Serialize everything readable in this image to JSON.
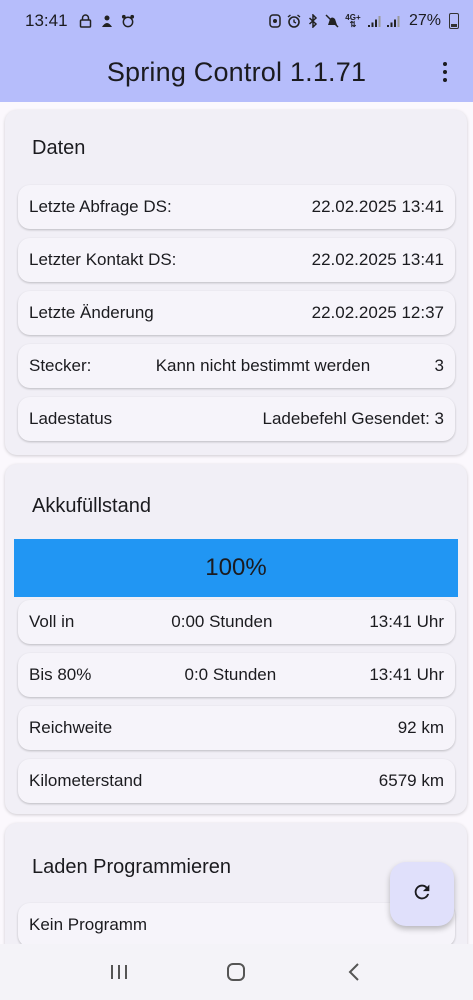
{
  "status_bar": {
    "time": "13:41",
    "battery": "27%",
    "signal_label": "4G+"
  },
  "app": {
    "title": "Spring Control 1.1.71"
  },
  "daten": {
    "title": "Daten",
    "rows": [
      {
        "label": "Letzte Abfrage DS:",
        "value": "22.02.2025 13:41"
      },
      {
        "label": "Letzter Kontakt DS:",
        "value": "22.02.2025 13:41"
      },
      {
        "label": "Letzte Änderung",
        "value": "22.02.2025 12:37"
      },
      {
        "label": "Stecker:",
        "middle": "Kann nicht bestimmt werden",
        "value": "3"
      },
      {
        "label": "Ladestatus",
        "value": "Ladebefehl Gesendet: 3"
      }
    ]
  },
  "akku": {
    "title": "Akkufüllstand",
    "level_text": "100%",
    "level": 1.0,
    "bar_color": "#2196f3",
    "rows": [
      {
        "label": "Voll in",
        "middle": "0:00 Stunden",
        "value": "13:41 Uhr"
      },
      {
        "label": "Bis 80%",
        "middle": "0:0 Stunden",
        "value": "13:41 Uhr"
      },
      {
        "label": "Reichweite",
        "value": "92 km"
      },
      {
        "label": "Kilometerstand",
        "value": "6579 km"
      }
    ]
  },
  "laden": {
    "title": "Laden Programmieren",
    "rows": [
      {
        "label": "Kein Programm"
      }
    ]
  },
  "colors": {
    "topbar": "#b6bdfb",
    "background": "#fbf8fd",
    "card": "#f1eff6",
    "fab": "#e0e0fb"
  },
  "icons": {
    "fab": "refresh-icon",
    "menu": "more-vert-icon",
    "nav": [
      "recent-apps-icon",
      "home-icon",
      "back-icon"
    ]
  }
}
